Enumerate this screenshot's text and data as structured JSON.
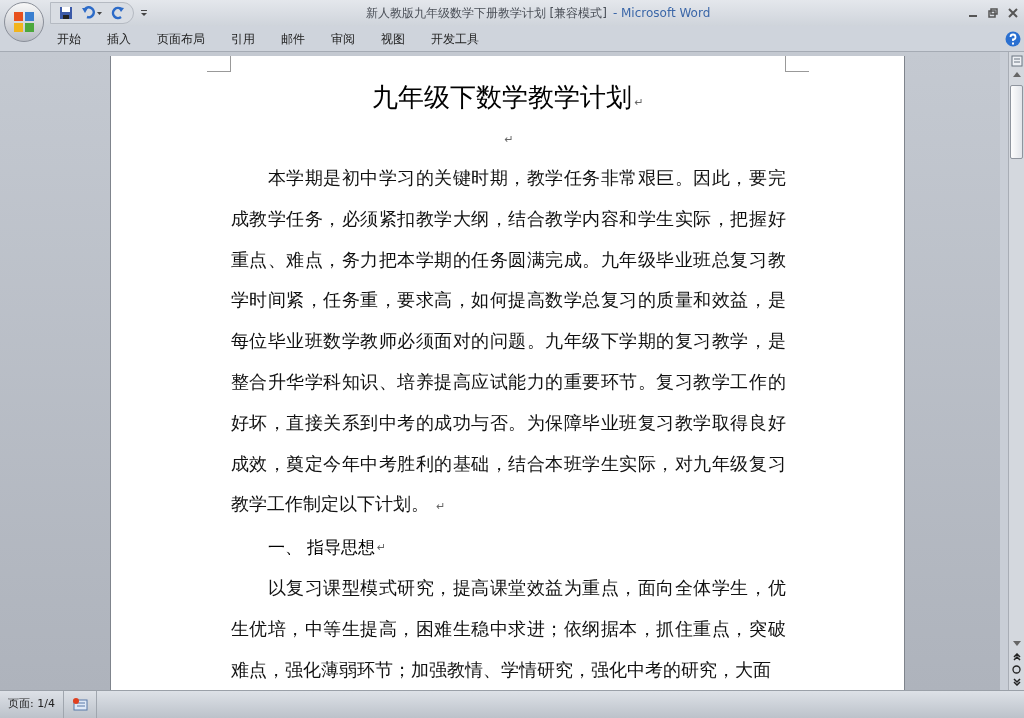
{
  "window": {
    "title": "新人教版九年级数学下册教学计划 [兼容模式]",
    "app": "- Microsoft Word"
  },
  "tabs": [
    {
      "label": "开始",
      "selected": false
    },
    {
      "label": "插入",
      "selected": false
    },
    {
      "label": "页面布局",
      "selected": false
    },
    {
      "label": "引用",
      "selected": false
    },
    {
      "label": "邮件",
      "selected": false
    },
    {
      "label": "审阅",
      "selected": false
    },
    {
      "label": "视图",
      "selected": false
    },
    {
      "label": "开发工具",
      "selected": false
    }
  ],
  "document": {
    "blocks": [
      {
        "kind": "title",
        "text": "九年级下数学教学计划",
        "mark": "↵"
      },
      {
        "kind": "empty",
        "mark": "↵"
      },
      {
        "kind": "body",
        "text": "本学期是初中学习的关键时期，教学任务非常艰巨。因此，要完成教学任务，必须紧扣教学大纲，结合教学内容和学生实际，把握好重点、难点，务力把本学期的任务圆满完成。九年级毕业班总复习教学时间紧，任务重，要求高，如何提高数学总复习的质量和效益，是每位毕业班数学教师必须面对的问题。九年级下学期的复习教学，是整合升华学科知识、培养提高应试能力的重要环节。复习教学工作的好坏，直接关系到中考的成功与否。为保障毕业班复习教学取得良好成效，奠定今年中考胜利的基础，结合本班学生实际，对九年级复习教学工作制定以下计划。",
        "mark": "↵"
      },
      {
        "kind": "heading",
        "text": "一、 指导思想",
        "mark": "↵"
      },
      {
        "kind": "body",
        "text": "以复习课型模式研究，提高课堂效益为重点，面向全体学生，优生优培，中等生提高，困难生稳中求进；依纲据本，抓住重点，突破难点，强化薄弱环节；加强教情、学情研究，强化中考的研究，大面"
      }
    ]
  },
  "status_bar": {
    "page": "页面: 1/4"
  }
}
